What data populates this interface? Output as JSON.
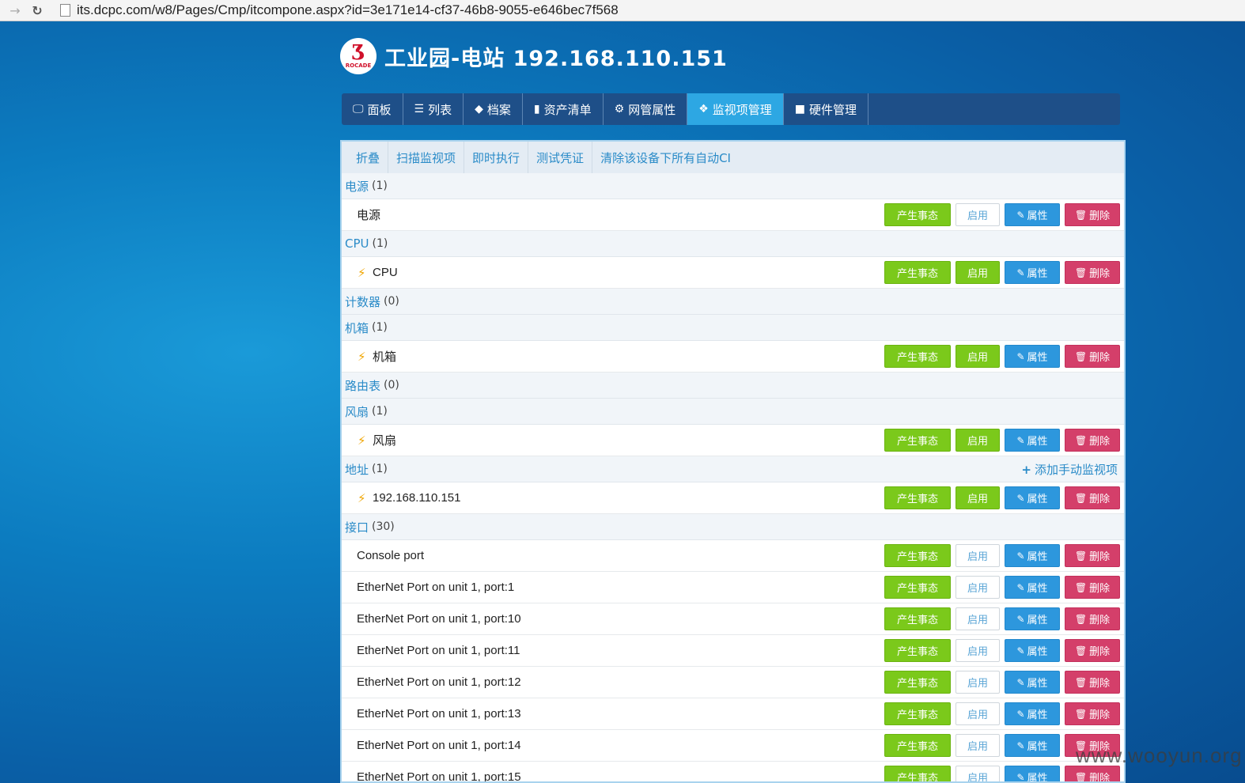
{
  "browser": {
    "url": "its.dcpc.com/w8/Pages/Cmp/itcompone.aspx?id=3e171e14-cf37-46b8-9055-e646bec7f568",
    "back_icon": "arrow-right-icon",
    "reload_icon": "reload-icon"
  },
  "header": {
    "logo_text": "ROCADE",
    "title": "工业园-电站 192.168.110.151"
  },
  "topnav": [
    {
      "label": "面板",
      "icon": "monitor-icon"
    },
    {
      "label": "列表",
      "icon": "list-icon"
    },
    {
      "label": "档案",
      "icon": "tag-icon"
    },
    {
      "label": "资产清单",
      "icon": "bookmark-icon"
    },
    {
      "label": "网管属性",
      "icon": "gear-icon"
    },
    {
      "label": "监视项管理",
      "icon": "puzzle-icon",
      "active": true
    },
    {
      "label": "硬件管理",
      "icon": "video-icon"
    }
  ],
  "subnav": [
    "折叠",
    "扫描监视项",
    "即时执行",
    "测试凭证",
    "清除该设备下所有自动CI"
  ],
  "buttons": {
    "event": "产生事态",
    "enable": "启用",
    "prop": "属性",
    "del": "删除",
    "add_manual": "添加手动监视项"
  },
  "groups": [
    {
      "name": "电源",
      "count": "(1)",
      "items": [
        {
          "name": "电源",
          "bolt": false,
          "enabled": false
        }
      ]
    },
    {
      "name": "CPU",
      "count": "(1)",
      "items": [
        {
          "name": "CPU",
          "bolt": true,
          "enabled": true
        }
      ]
    },
    {
      "name": "计数器",
      "count": "(0)",
      "items": []
    },
    {
      "name": "机箱",
      "count": "(1)",
      "items": [
        {
          "name": "机箱",
          "bolt": true,
          "enabled": true
        }
      ]
    },
    {
      "name": "路由表",
      "count": "(0)",
      "items": []
    },
    {
      "name": "风扇",
      "count": "(1)",
      "items": [
        {
          "name": "风扇",
          "bolt": true,
          "enabled": true
        }
      ]
    },
    {
      "name": "地址",
      "count": "(1)",
      "add_link": true,
      "items": [
        {
          "name": "192.168.110.151",
          "bolt": true,
          "enabled": true
        }
      ]
    },
    {
      "name": "接口",
      "count": "(30)",
      "items": [
        {
          "name": "Console port",
          "bolt": false,
          "enabled": false
        },
        {
          "name": "EtherNet Port on unit 1, port:1",
          "bolt": false,
          "enabled": false
        },
        {
          "name": "EtherNet Port on unit 1, port:10",
          "bolt": false,
          "enabled": false
        },
        {
          "name": "EtherNet Port on unit 1, port:11",
          "bolt": false,
          "enabled": false
        },
        {
          "name": "EtherNet Port on unit 1, port:12",
          "bolt": false,
          "enabled": false
        },
        {
          "name": "EtherNet Port on unit 1, port:13",
          "bolt": false,
          "enabled": false
        },
        {
          "name": "EtherNet Port on unit 1, port:14",
          "bolt": false,
          "enabled": false
        },
        {
          "name": "EtherNet Port on unit 1, port:15",
          "bolt": false,
          "enabled": false
        }
      ]
    }
  ],
  "watermark": "www.wooyun.org",
  "colors": {
    "event_green": "#7bc91b",
    "prop_blue": "#2d97dd",
    "delete_pink": "#d43f6a",
    "nav_active": "#2da7e3",
    "nav_bg": "#1e4f88"
  }
}
